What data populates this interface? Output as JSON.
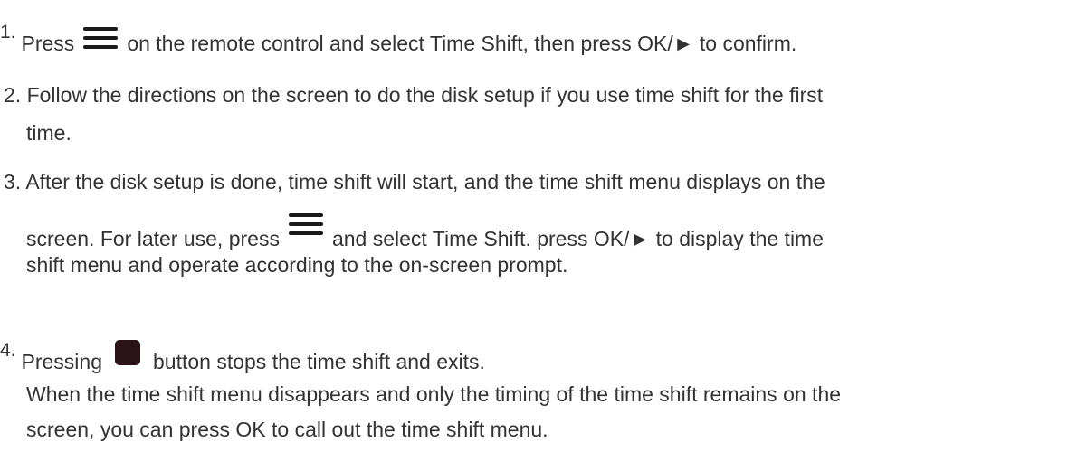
{
  "steps": [
    {
      "number": "1.",
      "before": "Press",
      "icon": "menu-icon",
      "after": "on the remote control and select Time Shift, then press OK/► to confirm."
    },
    {
      "number": "2.",
      "line1": "Follow the directions on the screen to do the disk setup if you use time shift for the first",
      "line2": "time."
    },
    {
      "number": "3.",
      "line1": "After the disk setup is done, time shift will start, and the time shift menu displays on the",
      "line2_before": "screen. For later use, press",
      "line2_icon": "menu-icon",
      "line2_after": "and select Time Shift. press OK/► to display the time",
      "line3": "shift menu and operate according to the on-screen prompt."
    },
    {
      "number": "4.",
      "before": "Pressing",
      "icon": "stop-icon",
      "after": "button stops the time shift and exits.",
      "note_line1": "When the time shift menu disappears and only the timing of the time shift remains on the",
      "note_line2": "screen, you can press OK to call out the time shift menu."
    }
  ],
  "colors": {
    "text": "#333333",
    "icon": "#1a1a1a",
    "stop_icon": "#2a1216"
  }
}
